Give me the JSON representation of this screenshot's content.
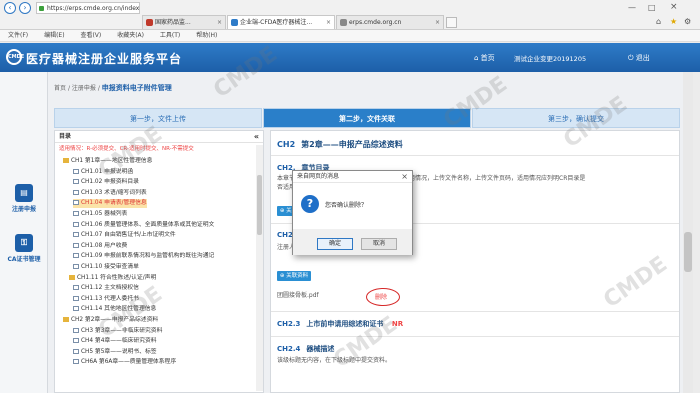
{
  "browser": {
    "address": "https://erps.cmde.org.cn/index",
    "tabs": [
      {
        "label": "国家药品监...",
        "color": "#c0392b"
      },
      {
        "label": "企业端-CFDA医疗器械注...",
        "color": "#2e7bc8"
      },
      {
        "label": "erps.cmde.org.cn",
        "color": "#888888"
      }
    ],
    "menu": [
      "文件(F)",
      "编辑(E)",
      "查看(V)",
      "收藏夹(A)",
      "工具(T)",
      "帮助(H)"
    ]
  },
  "header": {
    "title": "医疗器械注册企业服务平台",
    "home": "首页",
    "user": "测试企业变更20191205",
    "logout": "退出",
    "colors": {
      "primary": "#1d5fa8",
      "accent": "#2a8fd3",
      "warning": "#e44444"
    }
  },
  "sidebar": {
    "items": [
      {
        "label": "注册申报",
        "icon": "register-icon"
      },
      {
        "label": "CA证书管理",
        "icon": "ca-certificate-icon"
      }
    ]
  },
  "breadcrumb": {
    "home": "首页",
    "sep": "/",
    "level1": "注册申报",
    "current": "申报资料电子附件管理"
  },
  "steps": [
    "第一步，文件上传",
    "第二步，文件关联",
    "第三步，确认提交"
  ],
  "directory": {
    "title": "目录",
    "collapse": "«",
    "legend": "适用情况：R-必须提交、CR-适用时提交、NR-不需提交",
    "items": [
      {
        "label": "CH1 第1章——地区性管理信息",
        "type": "folder",
        "selected": false
      },
      {
        "label": "CH1.01 申报说明函",
        "type": "doc",
        "selected": false
      },
      {
        "label": "CH1.02 申报资料目录",
        "type": "doc",
        "selected": false
      },
      {
        "label": "CH1.03 术语/缩写词列表",
        "type": "doc",
        "selected": false
      },
      {
        "label": "CH1.04 申请表/管理信息",
        "type": "doc",
        "selected": true
      },
      {
        "label": "CH1.05 器械列表",
        "type": "doc",
        "selected": false
      },
      {
        "label": "CH1.06 质量管理体系、全面质量体系或其他证明文",
        "type": "doc",
        "selected": false
      },
      {
        "label": "CH1.07 自由销售证书/上市证明文件",
        "type": "doc",
        "selected": false
      },
      {
        "label": "CH1.08 用户收费",
        "type": "doc",
        "selected": false
      },
      {
        "label": "CH1.09 申报前联系情况和与监管机构的既往沟通记",
        "type": "doc",
        "selected": false
      },
      {
        "label": "CH1.10 接受审查清单",
        "type": "doc",
        "selected": false
      },
      {
        "label": "CH1.11 符合性陈述/认证/声明",
        "type": "folder",
        "selected": false
      },
      {
        "label": "CH1.12 主文档授权信",
        "type": "doc",
        "selected": false
      },
      {
        "label": "CH1.13 代理人委托书",
        "type": "doc",
        "selected": false
      },
      {
        "label": "CH1.14 其他地区性管理信息",
        "type": "doc",
        "selected": false
      },
      {
        "label": "CH2 第2章——申报产品综述资料",
        "type": "folder",
        "selected": false
      },
      {
        "label": "CH3 第3章——非临床研究资料",
        "type": "doc",
        "selected": false
      },
      {
        "label": "CH4 第4章——临床研究资料",
        "type": "doc",
        "selected": false
      },
      {
        "label": "CH5 第5章——说明书、标签",
        "type": "doc",
        "selected": false
      },
      {
        "label": "CH6A 第6A章——质量管理体系程序",
        "type": "doc",
        "selected": false
      }
    ]
  },
  "content": {
    "heading_code": "CH2",
    "heading": "第2章——申报产品综述资料",
    "section1_code": "CH2.",
    "section1_title": "章节目录",
    "section1_desc_a": "本章节",
    "section1_desc_b": "按提交资料的章节目录，显示章节标题、适用情况，上传文件名称，上传文件页码，适用情况应列明CR目录是",
    "section1_desc_c": "否适用",
    "upload_label": "关联资料",
    "section2_code": "CH2.",
    "section2_desc": "注册人应",
    "file_name": "团圆接骨板.pdf",
    "delete_label": "删除",
    "section3_code": "CH2.3",
    "section3_title": "上市前申请用综述和证书",
    "section3_badge": "NR",
    "section4_code": "CH2.4",
    "section4_title": "器械描述",
    "section4_desc": "该级标题无内容，在下级标题中提交资料。"
  },
  "dialog": {
    "title": "来自网页的消息",
    "close": "×",
    "icon": "question-icon",
    "message": "您否确认删除？",
    "ok": "确定",
    "cancel": "取消"
  },
  "watermark": "CMDE"
}
